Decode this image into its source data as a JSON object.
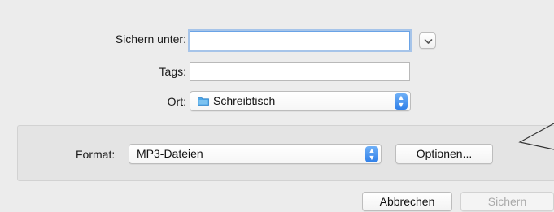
{
  "dialog": {
    "save_as": {
      "label": "Sichern unter:",
      "value": ""
    },
    "tags": {
      "label": "Tags:",
      "value": ""
    },
    "location": {
      "label": "Ort:",
      "value": "Schreibtisch",
      "icon": "folder-icon"
    },
    "expand_icon": "chevron-down-icon",
    "format": {
      "label": "Format:",
      "value": "MP3-Dateien"
    },
    "options_button": "Optionen...",
    "cancel_button": "Abbrechen",
    "save_button": "Sichern",
    "accent_color": "#2f7fe8",
    "folder_color": "#4ea7e8"
  }
}
